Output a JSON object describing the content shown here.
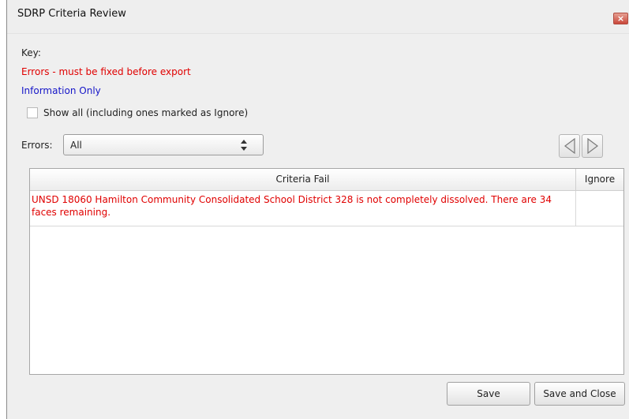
{
  "window": {
    "title": "SDRP Criteria Review",
    "close_label": "×"
  },
  "key": {
    "label": "Key:",
    "errors": "Errors - must be fixed before export",
    "info": "Information Only"
  },
  "show_all": {
    "label": "Show all (including ones marked as Ignore)",
    "checked": false
  },
  "filter": {
    "label": "Errors:",
    "value": "All"
  },
  "table": {
    "columns": [
      "Criteria Fail",
      "Ignore"
    ],
    "rows": [
      {
        "criteria": "UNSD 18060 Hamilton Community Consolidated School District 328 is not completely dissolved. There are 34 faces remaining.",
        "ignore": ""
      }
    ]
  },
  "buttons": {
    "save": "Save",
    "save_close": "Save and Close"
  },
  "colors": {
    "error": "#e00000",
    "info": "#1515c8"
  },
  "icons": {
    "prev": "left-triangle-icon",
    "next": "right-triangle-icon",
    "close": "close-icon"
  }
}
